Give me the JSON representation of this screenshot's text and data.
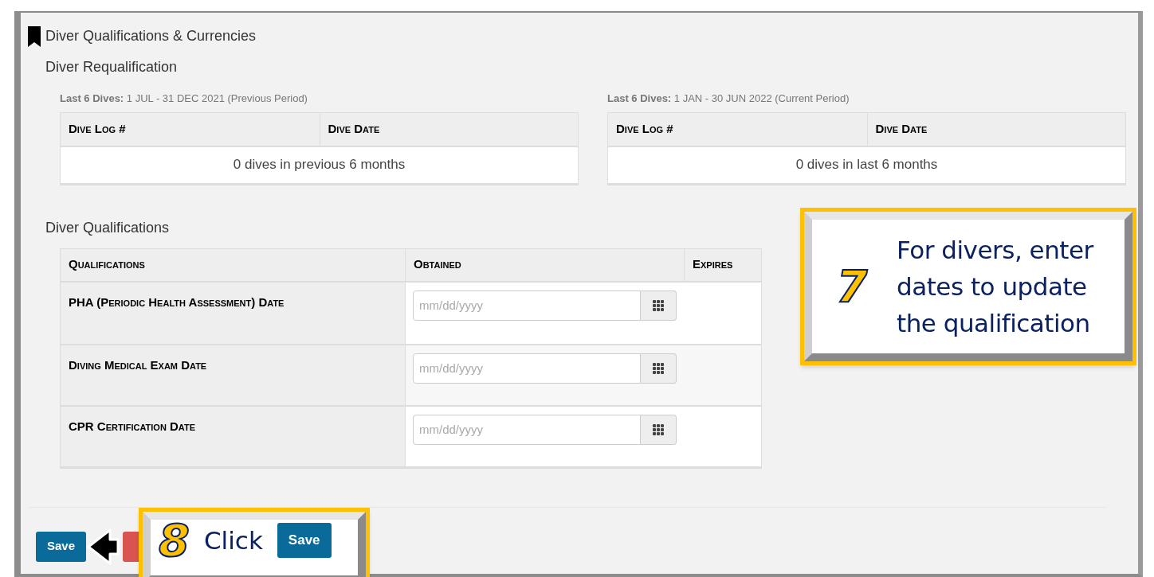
{
  "section_title": "Diver Qualifications & Currencies",
  "requalification": {
    "title": "Diver Requalification",
    "tables": [
      {
        "caption_label": "Last 6 Dives:",
        "caption_text": "1 JUL - 31 DEC 2021 (Previous Period)",
        "columns": [
          "Dive Log #",
          "Dive Date"
        ],
        "empty_message": "0 dives in previous 6 months"
      },
      {
        "caption_label": "Last 6 Dives:",
        "caption_text": "1 JAN - 30 JUN 2022 (Current Period)",
        "columns": [
          "Dive Log #",
          "Dive Date"
        ],
        "empty_message": "0 dives in last 6 months"
      }
    ]
  },
  "qualifications": {
    "title": "Diver Qualifications",
    "columns": [
      "Qualifications",
      "Obtained",
      "Expires"
    ],
    "rows": [
      {
        "name": "PHA (Periodic Health Assessment) Date",
        "placeholder": "mm/dd/yyyy"
      },
      {
        "name": "Diving Medical Exam Date",
        "placeholder": "mm/dd/yyyy"
      },
      {
        "name": "CPR Certification Date",
        "placeholder": "mm/dd/yyyy"
      }
    ]
  },
  "buttons": [
    {
      "label": "Save",
      "kind": "primary"
    }
  ],
  "callouts": [
    {
      "number": "7",
      "text": "For divers, enter dates to update the qualification"
    },
    {
      "number": "8",
      "text": "Click",
      "button": "Save"
    }
  ]
}
